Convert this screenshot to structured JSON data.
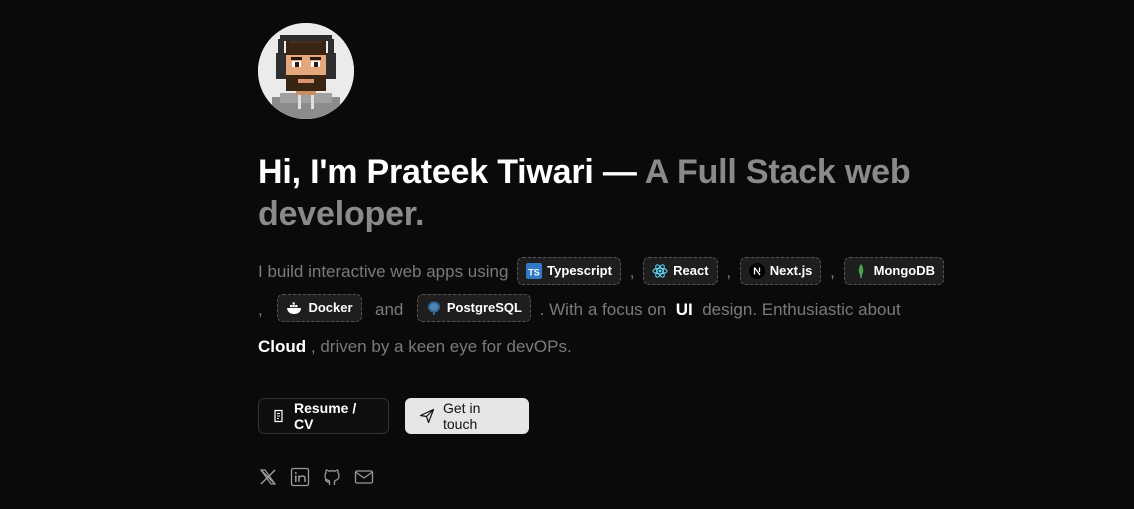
{
  "profile": {
    "avatar_alt": "pixel-art avatar with headphones"
  },
  "hero": {
    "lead": "Hi, I'm Prateek Tiwari — ",
    "role": "A Full Stack web developer."
  },
  "bio": {
    "intro": "I build interactive web apps using",
    "sep_comma": ",",
    "and": "and",
    "focus_pre": ". With a focus on",
    "focus_word": "UI",
    "focus_post": "design. Enthusiastic about",
    "cloud_word": "Cloud",
    "ending": ", driven by a keen eye for devOPs.",
    "tech": [
      {
        "name": "Typescript",
        "icon": "typescript-icon"
      },
      {
        "name": "React",
        "icon": "react-icon"
      },
      {
        "name": "Next.js",
        "icon": "nextjs-icon"
      },
      {
        "name": "MongoDB",
        "icon": "mongodb-icon"
      },
      {
        "name": "Docker",
        "icon": "docker-icon"
      },
      {
        "name": "PostgreSQL",
        "icon": "postgresql-icon"
      }
    ]
  },
  "actions": {
    "resume_label": "Resume / CV",
    "contact_label": "Get in touch"
  },
  "socials": [
    {
      "name": "x-icon"
    },
    {
      "name": "linkedin-icon"
    },
    {
      "name": "github-icon"
    },
    {
      "name": "mail-icon"
    }
  ],
  "colors": {
    "background": "#0a0a0a",
    "muted_text": "#7a7a7a",
    "role_text": "#8a8a8a",
    "chip_bg": "#1e1e1e"
  }
}
